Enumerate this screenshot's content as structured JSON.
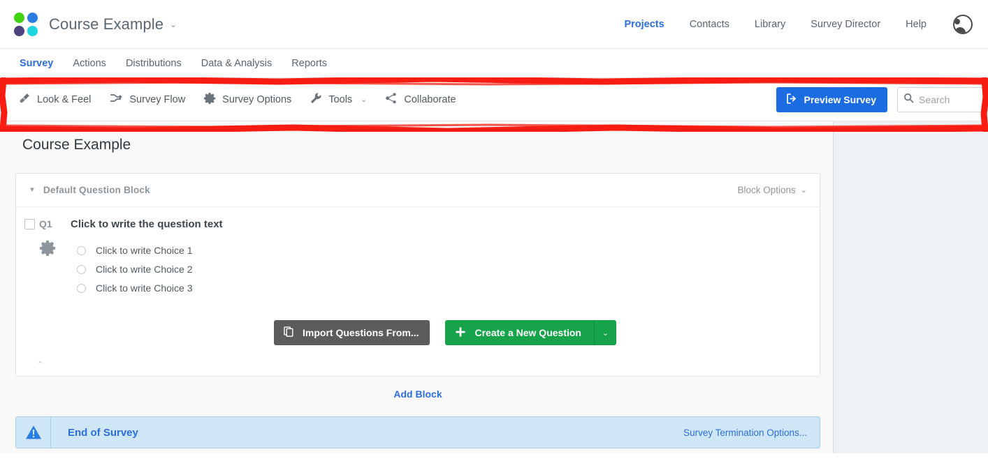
{
  "brand": {
    "title": "Course Example",
    "caret": "⌄",
    "logo_colors": [
      "#3fd40f",
      "#2a7de1",
      "#4a437c",
      "#1fd6e0"
    ]
  },
  "topnav": {
    "items": [
      {
        "label": "Projects",
        "active": true
      },
      {
        "label": "Contacts",
        "active": false
      },
      {
        "label": "Library",
        "active": false
      },
      {
        "label": "Survey Director",
        "active": false
      },
      {
        "label": "Help",
        "active": false
      }
    ],
    "avatar": "user-avatar"
  },
  "tabs": [
    {
      "label": "Survey",
      "active": true
    },
    {
      "label": "Actions",
      "active": false
    },
    {
      "label": "Distributions",
      "active": false
    },
    {
      "label": "Data & Analysis",
      "active": false
    },
    {
      "label": "Reports",
      "active": false
    }
  ],
  "toolbar": {
    "look_and_feel": "Look & Feel",
    "survey_flow": "Survey Flow",
    "survey_options": "Survey Options",
    "tools": "Tools",
    "tools_caret": "⌄",
    "collaborate": "Collaborate",
    "preview_label": "Preview Survey",
    "search_placeholder": "Search",
    "search_value": "",
    "highlight_color": "#f81c12"
  },
  "main": {
    "page_title": "Course Example",
    "block": {
      "caret": "▼",
      "name": "Default Question Block",
      "options_label": "Block Options",
      "options_caret": "⌄",
      "foot_caret": "⌃"
    },
    "question": {
      "id": "Q1",
      "text": "Click to write the question text",
      "choices": [
        "Click to write Choice 1",
        "Click to write Choice 2",
        "Click to write Choice 3"
      ]
    },
    "actions": {
      "import_label": "Import Questions From...",
      "create_label": "Create a New Question",
      "create_caret": "⌄"
    },
    "add_block_label": "Add Block",
    "end_of_survey": {
      "label": "End of Survey",
      "link": "Survey Termination Options..."
    }
  }
}
